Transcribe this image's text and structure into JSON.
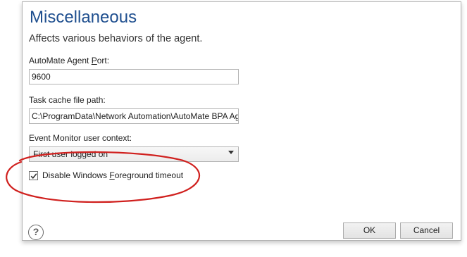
{
  "dialog": {
    "title": "Miscellaneous",
    "subtitle": "Affects various behaviors of the agent."
  },
  "port": {
    "label_pre": "AutoMate Agent ",
    "label_accel": "P",
    "label_post": "ort:",
    "value": "9600"
  },
  "cache": {
    "label": "Task cache file path:",
    "value": "C:\\ProgramData\\Network Automation\\AutoMate BPA Agent"
  },
  "event_monitor": {
    "label": "Event Monitor user context:",
    "selected": "First user logged on"
  },
  "foreground": {
    "checked": true,
    "label_pre": "Disable Windows ",
    "label_accel": "F",
    "label_post": "oreground timeout"
  },
  "footer": {
    "help_glyph": "?",
    "ok_label": "OK",
    "cancel_label": "Cancel"
  },
  "annotation": {
    "color": "#d0201e"
  },
  "icons": {
    "help": "help-icon",
    "check": "checkmark-icon",
    "dropdown": "chevron-down-icon"
  }
}
